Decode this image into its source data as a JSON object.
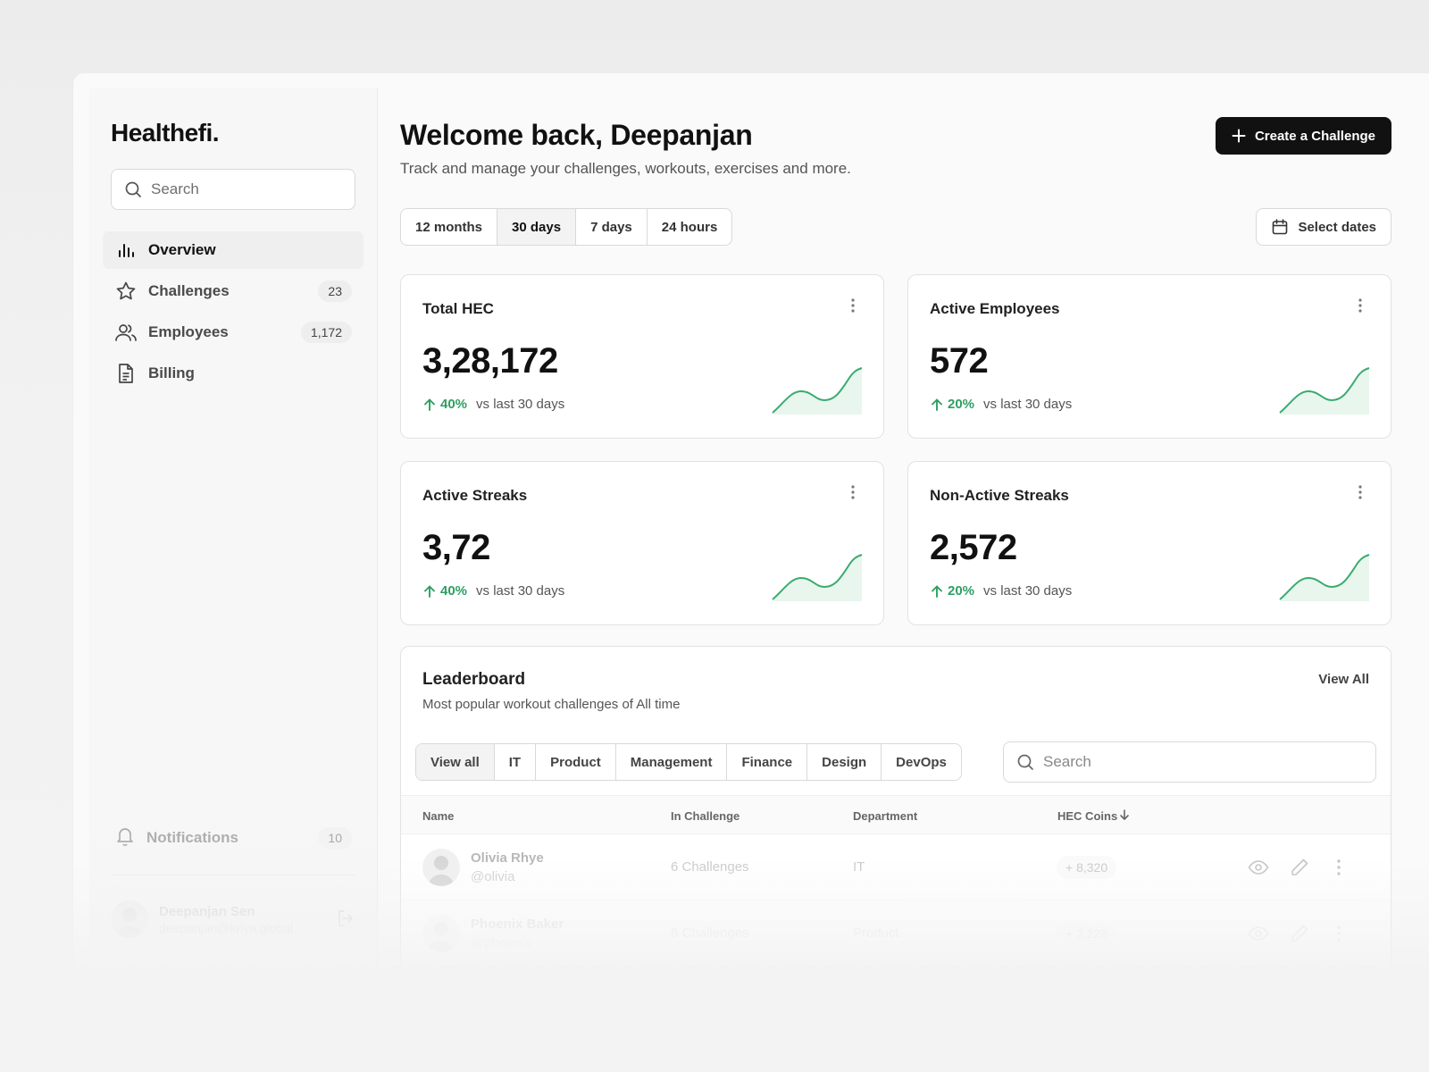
{
  "sidebar": {
    "logo": "Healthefi.",
    "search_placeholder": "Search",
    "items": [
      {
        "label": "Overview",
        "icon": "bar-chart-icon",
        "badge": ""
      },
      {
        "label": "Challenges",
        "icon": "star-icon",
        "badge": "23"
      },
      {
        "label": "Employees",
        "icon": "users-icon",
        "badge": "1,172"
      },
      {
        "label": "Billing",
        "icon": "file-icon",
        "badge": ""
      }
    ],
    "notifications": {
      "label": "Notifications",
      "badge": "10"
    },
    "user": {
      "name": "Deepanjan Sen",
      "email": "deepanjan@kriya.global"
    }
  },
  "header": {
    "title": "Welcome back, Deepanjan",
    "subtitle": "Track and manage your challenges, workouts, exercises and more.",
    "create_button": "Create a Challenge"
  },
  "range": {
    "options": [
      "12 months",
      "30 days",
      "7 days",
      "24 hours"
    ],
    "selected": "30 days",
    "select_dates": "Select dates"
  },
  "stats": [
    {
      "title": "Total HEC",
      "value": "3,28,172",
      "change": "40%",
      "compare": "vs last 30 days"
    },
    {
      "title": "Active Employees",
      "value": "572",
      "change": "20%",
      "compare": "vs last 30 days"
    },
    {
      "title": "Active Streaks",
      "value": "3,72",
      "change": "40%",
      "compare": "vs last 30 days"
    },
    {
      "title": "Non-Active Streaks",
      "value": "2,572",
      "change": "20%",
      "compare": "vs last 30 days"
    }
  ],
  "colors": {
    "accent": "#111111",
    "positive": "#2f9e63",
    "spark_fill": "#e8f6ee"
  },
  "leaderboard": {
    "title": "Leaderboard",
    "subtitle": "Most popular workout challenges of All time",
    "view_all": "View All",
    "filters": [
      "View all",
      "IT",
      "Product",
      "Management",
      "Finance",
      "Design",
      "DevOps"
    ],
    "search_placeholder": "Search",
    "columns": {
      "name": "Name",
      "challenge": "In Challenge",
      "department": "Department",
      "coins": "HEC Coins"
    },
    "rows": [
      {
        "name": "Olivia Rhye",
        "handle": "@olivia",
        "challenges": "6 Challenges",
        "department": "IT",
        "coins": "+ 8,320"
      },
      {
        "name": "Phoenix Baker",
        "handle": "@phoenix",
        "challenges": "6 Challenges",
        "department": "Product",
        "coins": "+ 7,228"
      }
    ]
  }
}
